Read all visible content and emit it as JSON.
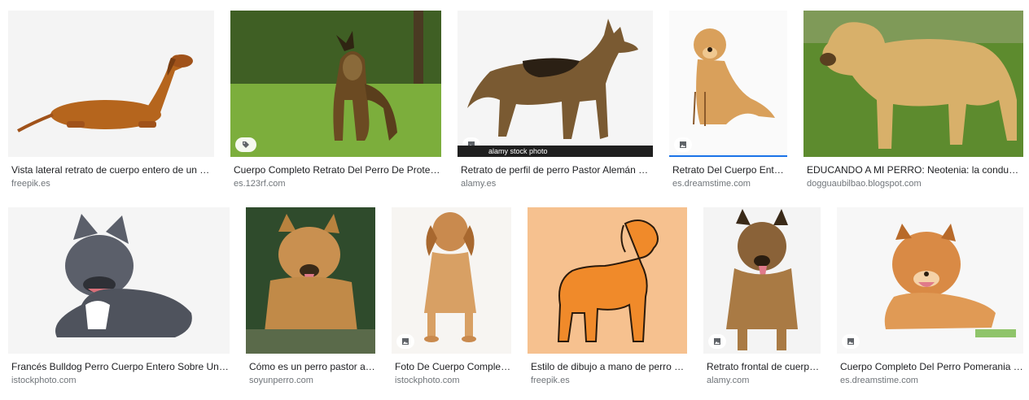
{
  "results": [
    {
      "title": "Vista lateral retrato de cuerpo entero de un perro salchicha",
      "source": "freepik.es"
    },
    {
      "title": "Cuerpo Completo Retrato Del Perro De Protección Pastor Alemán",
      "source": "es.123rf.com"
    },
    {
      "title": "Retrato de perfil de perro Pastor Alemán de cuerpo completo",
      "source": "alamy.es",
      "overlay": "alamy stock photo"
    },
    {
      "title": "Retrato Del Cuerpo Entero Del Perro",
      "source": "es.dreamstime.com"
    },
    {
      "title": "EDUCANDO A MI PERRO: Neotenia: la conducta del perro",
      "source": "dogguaubilbao.blogspot.com"
    },
    {
      "title": "Francés Bulldog Perro Cuerpo Entero Sobre Un Fondo Blanco",
      "source": "istockphoto.com"
    },
    {
      "title": "Cómo es un perro pastor alemán",
      "source": "soyunperro.com"
    },
    {
      "title": "Foto De Cuerpo Completo De Un Cachorro",
      "source": "istockphoto.com"
    },
    {
      "title": "Estilo de dibujo a mano de perro de cuerpo completo",
      "source": "freepik.es"
    },
    {
      "title": "Retrato frontal de cuerpo entero",
      "source": "alamy.com"
    },
    {
      "title": "Cuerpo Completo Del Perro Pomerania Sonriente",
      "source": "es.dreamstime.com"
    }
  ]
}
